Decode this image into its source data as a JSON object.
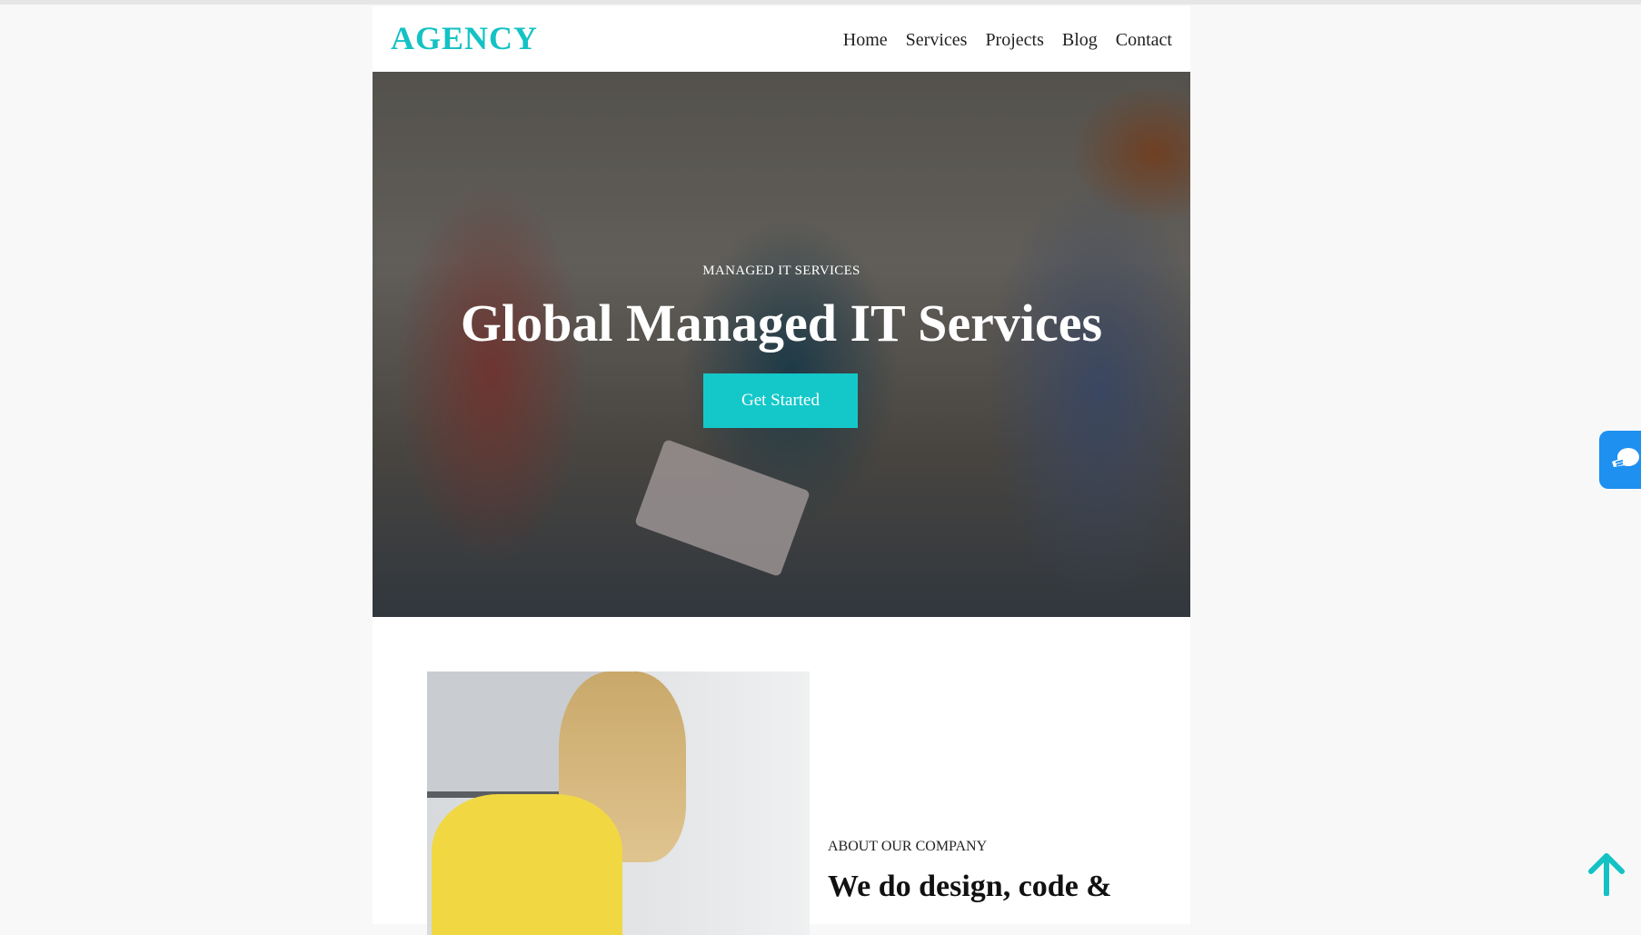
{
  "brand": {
    "logo": "AGENCY",
    "accent": "#14c2c4"
  },
  "nav": {
    "items": [
      "Home",
      "Services",
      "Projects",
      "Blog",
      "Contact"
    ]
  },
  "hero": {
    "eyebrow": "MANAGED IT SERVICES",
    "title": "Global Managed IT Services",
    "cta": "Get Started",
    "cta_color": "#14c8c9"
  },
  "about": {
    "eyebrow": "ABOUT OUR COMPANY",
    "title": "We do design, code &"
  },
  "widgets": {
    "chat_icon": "chat-hand-icon",
    "scroll_icon": "arrow-up-icon"
  }
}
